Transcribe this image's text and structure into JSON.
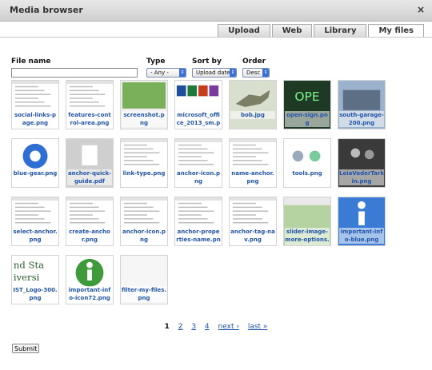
{
  "window": {
    "title": "Media browser",
    "close_glyph": "×"
  },
  "tabs": [
    {
      "label": "Upload",
      "active": false
    },
    {
      "label": "Web",
      "active": false
    },
    {
      "label": "Library",
      "active": false
    },
    {
      "label": "My files",
      "active": true
    }
  ],
  "filters": {
    "file_name": {
      "label": "File name",
      "value": "",
      "placeholder": ""
    },
    "type": {
      "label": "Type",
      "value": "- Any -"
    },
    "sort_by": {
      "label": "Sort by",
      "value": "Upload date"
    },
    "order": {
      "label": "Order",
      "value": "Desc"
    }
  },
  "files": [
    {
      "name": "social-links-page.png",
      "thumb": "doc-lines",
      "color": "#ffffff"
    },
    {
      "name": "features-control-area.png",
      "thumb": "doc-lines",
      "color": "#ffffff"
    },
    {
      "name": "screenshot.png",
      "thumb": "solid",
      "color": "#7ab05a"
    },
    {
      "name": "microsoft_office_2013_sm.png",
      "thumb": "office-icons",
      "color": "#ffffff"
    },
    {
      "name": "bob.jpg",
      "thumb": "dino",
      "color": "#9aa38a"
    },
    {
      "name": "open-sign.png",
      "thumb": "sign",
      "color": "#1e3a24"
    },
    {
      "name": "south-garage-200.png",
      "thumb": "building",
      "color": "#6f8fb3"
    },
    {
      "name": "blue-gear.png",
      "thumb": "gear-icon",
      "color": "#2f6fd4"
    },
    {
      "name": "anchor-quick-guide.pdf",
      "thumb": "pdf-icon",
      "color": "#d8d8d8"
    },
    {
      "name": "link-type.png",
      "thumb": "doc-lines",
      "color": "#ffffff"
    },
    {
      "name": "anchor-icon.png",
      "thumb": "doc-lines",
      "color": "#ffffff"
    },
    {
      "name": "name-anchor.png",
      "thumb": "doc-lines",
      "color": "#ffffff"
    },
    {
      "name": "tools.png",
      "thumb": "tools",
      "color": "#ffffff"
    },
    {
      "name": "LeiaVaderTarkin.png",
      "thumb": "photo-dark",
      "color": "#2a2a2a"
    },
    {
      "name": "select-anchor.png",
      "thumb": "doc-lines",
      "color": "#ffffff"
    },
    {
      "name": "create-anchor.png",
      "thumb": "doc-lines",
      "color": "#ffffff"
    },
    {
      "name": "anchor-icon.png",
      "thumb": "doc-lines",
      "color": "#ffffff"
    },
    {
      "name": "anchor-properties-name.png",
      "thumb": "doc-lines",
      "color": "#ffffff"
    },
    {
      "name": "anchor-tag-nav.png",
      "thumb": "doc-lines",
      "color": "#ffffff"
    },
    {
      "name": "slider-image-more-options.png",
      "thumb": "slider",
      "color": "#8fb87a"
    },
    {
      "name": "important-info-blue.png",
      "thumb": "info-blue",
      "color": "#3a7bd5"
    },
    {
      "name": "IST_Logo-300.png",
      "thumb": "logo-text",
      "color": "#ffffff"
    },
    {
      "name": "important-info-icon72.png",
      "thumb": "info-green",
      "color": "#3e9a3a"
    },
    {
      "name": "filter-my-files.png",
      "thumb": "blank",
      "color": "#f6f6f6"
    }
  ],
  "pager": {
    "pages": [
      "1",
      "2",
      "3",
      "4"
    ],
    "current": "1",
    "next": "next ›",
    "last": "last »"
  },
  "submit_label": "Submit"
}
